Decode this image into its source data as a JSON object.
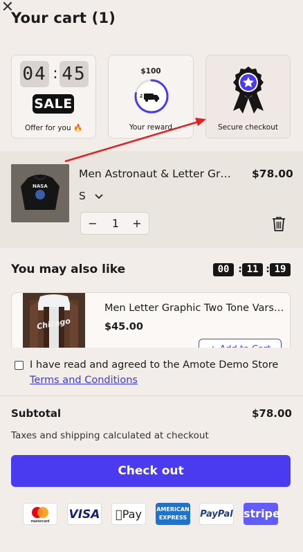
{
  "header": {
    "title": "Your cart (1)",
    "close_icon": "close-icon"
  },
  "promo_cards": {
    "offer": {
      "hours": "04",
      "minutes": "45",
      "badge": "SALE",
      "label": "Offer for you 🔥"
    },
    "reward": {
      "amount": "$100",
      "label": "Your reward",
      "icon": "truck-icon",
      "progress": 0.78
    },
    "secure": {
      "label": "Secure checkout",
      "icon": "award-badge-icon"
    }
  },
  "cart_item": {
    "title": "Men Astronaut & Letter Graphic Hoodie",
    "price": "$78.00",
    "variant": "S",
    "quantity": "1",
    "thumb_text": "NASA",
    "minus": "−",
    "plus": "+"
  },
  "recommendations": {
    "title": "You may also like",
    "timer": [
      "00",
      "11",
      "19"
    ],
    "product": {
      "title": "Men Letter Graphic Two Tone Varsity Jacket",
      "price": "$45.00",
      "add_label": "+ Add to Cart",
      "image_text": "Chicago"
    }
  },
  "terms": {
    "text": "I have read and agreed to the Amote Demo Store",
    "link": "Terms and Conditions",
    "checked": false
  },
  "summary": {
    "subtotal_label": "Subtotal",
    "subtotal_value": "$78.00",
    "tax_note": "Taxes and shipping calculated at checkout",
    "checkout_label": "Check out"
  },
  "payments": {
    "mastercard": "mastercard",
    "visa": "VISA",
    "applepay": "Pay",
    "amex_top": "AMERICAN",
    "amex_bottom": "EXPRESS",
    "paypal": "PayPal",
    "stripe": "stripe"
  },
  "colors": {
    "accent": "#4a3af0",
    "background": "#f2ede9",
    "link": "#3b3be0",
    "annotation_arrow": "#e81e1e"
  }
}
